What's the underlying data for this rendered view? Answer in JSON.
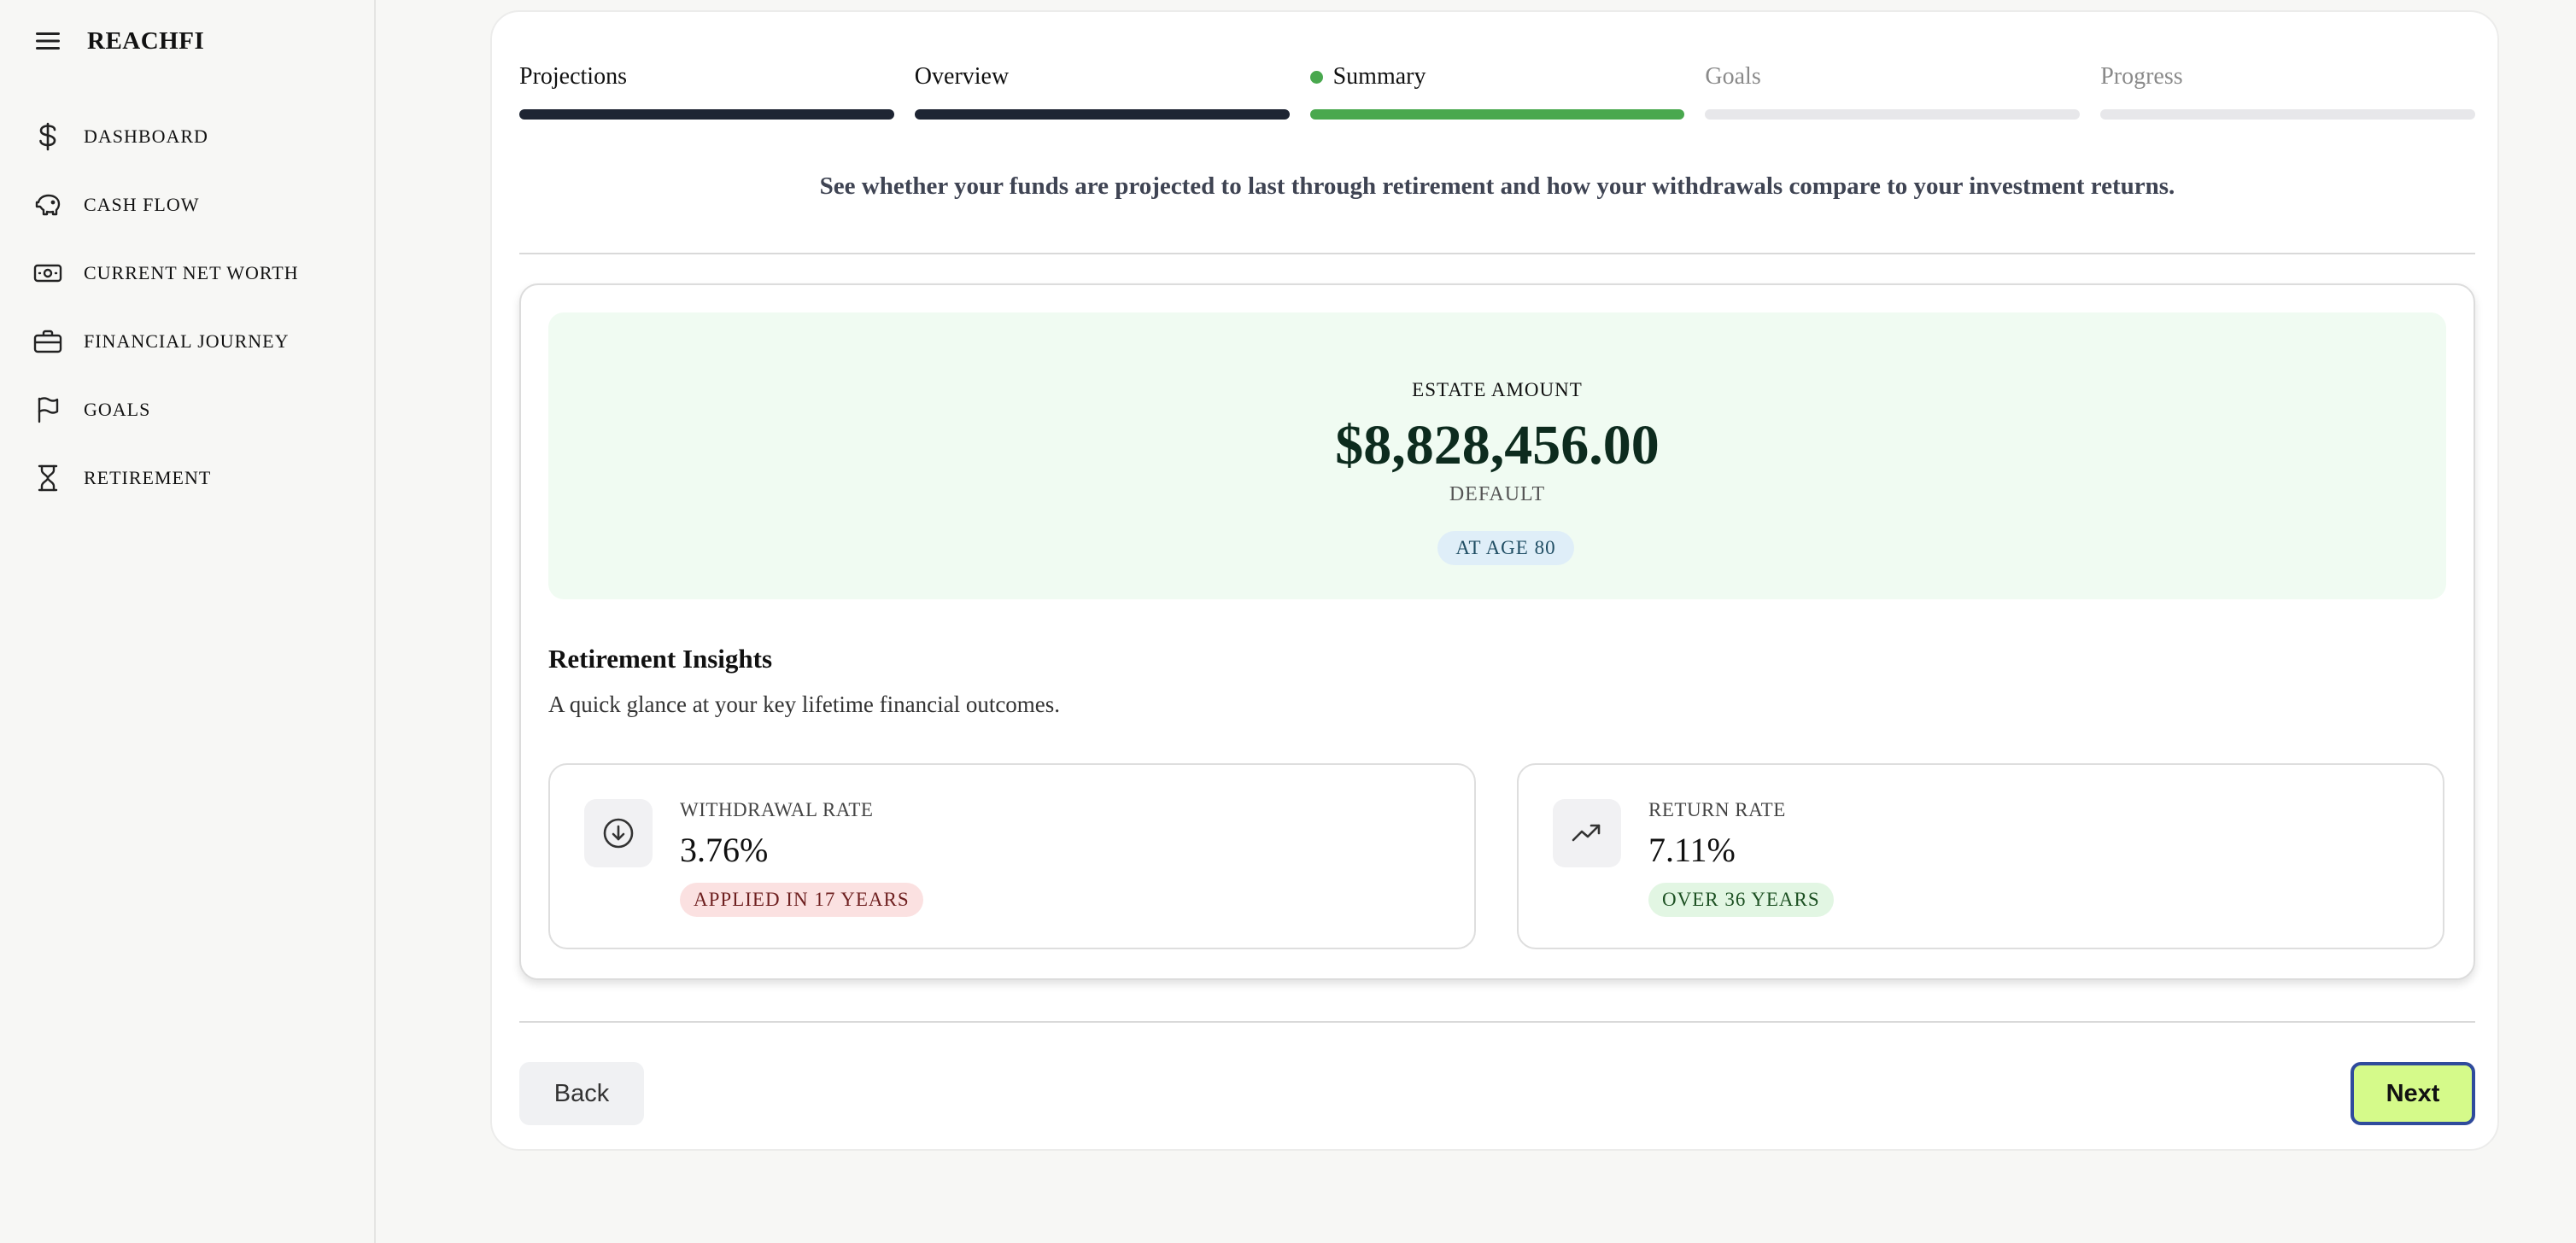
{
  "brand": {
    "name": "REACHFI"
  },
  "sidebar": {
    "items": [
      {
        "label": "DASHBOARD",
        "icon": "dollar-icon"
      },
      {
        "label": "CASH FLOW",
        "icon": "piggy-bank-icon"
      },
      {
        "label": "CURRENT NET WORTH",
        "icon": "banknote-icon"
      },
      {
        "label": "FINANCIAL JOURNEY",
        "icon": "briefcase-icon"
      },
      {
        "label": "GOALS",
        "icon": "flag-icon"
      },
      {
        "label": "RETIREMENT",
        "icon": "hourglass-icon"
      }
    ]
  },
  "steps": [
    {
      "label": "Projections",
      "state": "done"
    },
    {
      "label": "Overview",
      "state": "done"
    },
    {
      "label": "Summary",
      "state": "active"
    },
    {
      "label": "Goals",
      "state": "todo"
    },
    {
      "label": "Progress",
      "state": "todo"
    }
  ],
  "main": {
    "subtitle": "See whether your funds are projected to last through retirement and how your withdrawals compare to your investment returns."
  },
  "estate": {
    "label": "ESTATE AMOUNT",
    "amount": "$8,828,456.00",
    "scenario": "DEFAULT",
    "age_badge": "AT AGE 80"
  },
  "insights": {
    "title": "Retirement Insights",
    "description": "A quick glance at your key lifetime financial outcomes.",
    "withdrawal": {
      "label": "WITHDRAWAL RATE",
      "value": "3.76%",
      "badge": "APPLIED IN 17 YEARS",
      "icon": "arrow-down-circle-icon"
    },
    "return": {
      "label": "RETURN RATE",
      "value": "7.11%",
      "badge": "OVER 36 YEARS",
      "icon": "trending-up-icon"
    }
  },
  "buttons": {
    "back": "Back",
    "next": "Next"
  },
  "colors": {
    "active_step": "#49a84e",
    "done_step": "#1e2533",
    "estate_bg": "#f0fbf2",
    "next_button": "#d5fa8a",
    "next_border": "#2f4b9c"
  }
}
